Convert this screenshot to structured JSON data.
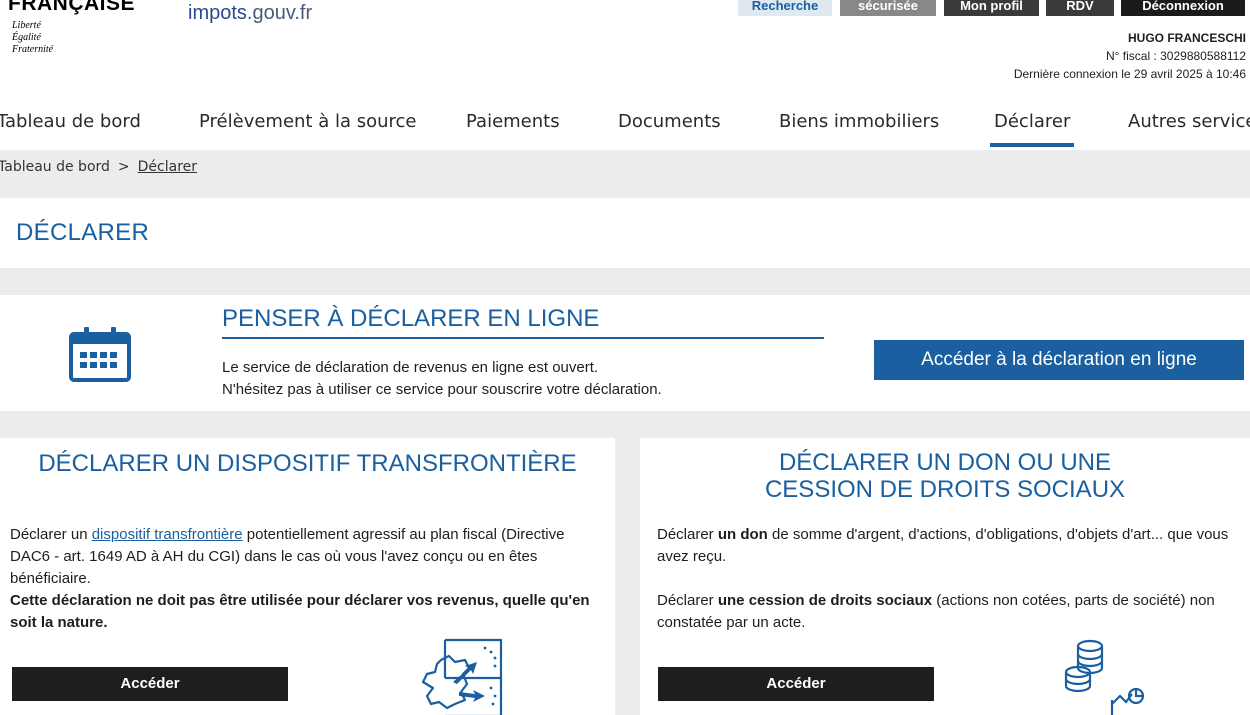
{
  "header": {
    "republique": "FRANÇAISE",
    "devise": [
      "Liberté",
      "Égalité",
      "Fraternité"
    ],
    "logo_main": "impots",
    "logo_suffix": ".gouv.fr",
    "top_buttons": {
      "recherche": "Recherche",
      "messagerie": "sécurisée",
      "profil": "Mon profil",
      "rdv": "RDV",
      "deconnexion": "Déconnexion"
    },
    "user": {
      "name": "HUGO FRANCESCHI",
      "fiscal": "N° fiscal : 3029880588112",
      "last_login": "Dernière connexion le 29 avril 2025 à 10:46"
    }
  },
  "nav": {
    "items": [
      {
        "label": "Tableau de bord"
      },
      {
        "label": "Prélèvement à la source"
      },
      {
        "label": "Paiements"
      },
      {
        "label": "Documents"
      },
      {
        "label": "Biens immobiliers"
      },
      {
        "label": "Déclarer"
      },
      {
        "label": "Autres services"
      }
    ],
    "active": "Déclarer"
  },
  "breadcrumb": {
    "home": "Tableau de bord",
    "separator": ">",
    "current": "Déclarer"
  },
  "page": {
    "title": "DÉCLARER"
  },
  "banner": {
    "icon": "calendar-icon",
    "title": "PENSER À DÉCLARER EN LIGNE",
    "line1": "Le service de déclaration de revenus en ligne est ouvert.",
    "line2": "N'hésitez pas à utiliser ce service pour souscrire votre déclaration.",
    "button": "Accéder à la déclaration en ligne"
  },
  "card_dac6": {
    "title": "DÉCLARER UN DISPOSITIF TRANSFRONTIÈRE",
    "text_prefix": "Déclarer un ",
    "text_link": "dispositif transfrontière",
    "text_suffix": " potentiellement agressif au plan fiscal (Directive DAC6 - art. 1649 AD à AH du CGI) dans le cas où vous l'avez conçu ou en êtes bénéficiaire.",
    "warning": "Cette déclaration ne doit pas être utilisée pour déclarer vos revenus, quelle qu'en soit la nature.",
    "button": "Accéder",
    "icon": "cross-border-map-icon"
  },
  "card_don": {
    "title_line1": "DÉCLARER UN DON OU UNE",
    "title_line2": "CESSION DE DROITS SOCIAUX",
    "p1_prefix": "Déclarer ",
    "p1_bold": "un don",
    "p1_suffix": " de somme d'argent, d'actions, d'obligations, d'objets d'art... que vous avez reçu.",
    "p2_prefix": "Déclarer ",
    "p2_bold": "une cession de droits sociaux",
    "p2_suffix": " (actions non cotées, parts de société) non constatée par un acte.",
    "button": "Accéder",
    "icon": "coins-chart-icon"
  },
  "colors": {
    "primary_blue": "#1a5fa0",
    "dark_button": "#1e1e1e",
    "background_gray": "#ececec"
  }
}
